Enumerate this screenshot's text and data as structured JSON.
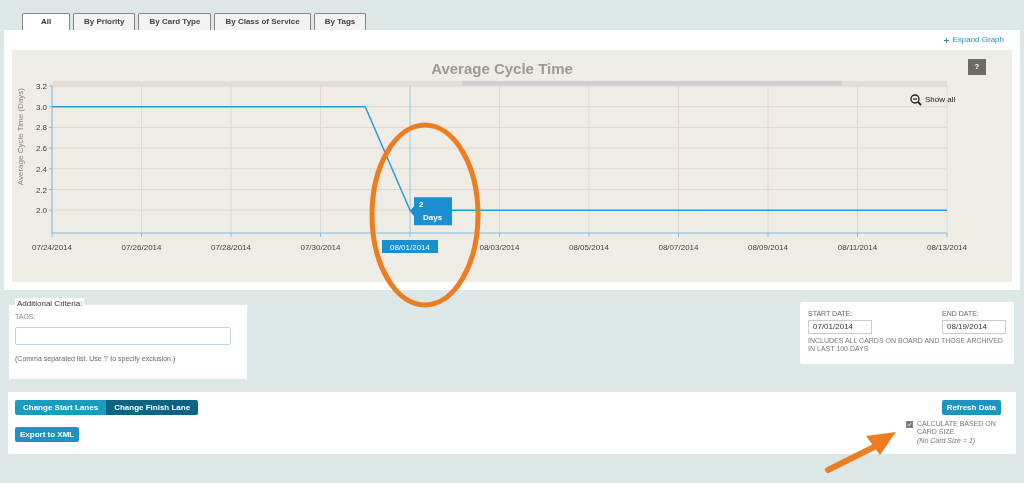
{
  "tabs": [
    {
      "label": "All",
      "selected": true
    },
    {
      "label": "By Priority",
      "selected": false
    },
    {
      "label": "By Card Type",
      "selected": false
    },
    {
      "label": "By Class of Service",
      "selected": false
    },
    {
      "label": "By Tags",
      "selected": false
    }
  ],
  "expand_link": "Expand Graph",
  "help_button": "?",
  "show_all": "Show all",
  "chart": {
    "chart_data": {
      "type": "line",
      "title": "Average Cycle Time",
      "ylabel": "Average Cycle Time (Days)",
      "categories": [
        "07/24/2014",
        null,
        "07/26/2014",
        null,
        "07/28/2014",
        null,
        "07/30/2014",
        null,
        "08/01/2014",
        null,
        "08/03/2014",
        null,
        "08/05/2014",
        null,
        "08/07/2014",
        null,
        "08/09/2014",
        null,
        "08/11/2014",
        null,
        "08/13/2014"
      ],
      "series": [
        {
          "color": "#2a9fd6",
          "values": [
            3.0,
            3.0,
            3.0,
            3.0,
            3.0,
            3.0,
            3.0,
            3.0,
            2.0,
            2.0,
            2.0,
            2.0,
            2.0,
            2.0,
            2.0,
            2.0,
            2.0,
            2.0,
            2.0,
            2.0,
            2.0
          ]
        }
      ],
      "ylim": [
        1.78,
        3.2
      ],
      "yticks": [
        {
          "value": 2.0,
          "label": "2.0"
        },
        {
          "value": 2.2,
          "label": "2.2"
        },
        {
          "value": 2.4,
          "label": "2.4"
        },
        {
          "value": 2.6,
          "label": "2.6"
        },
        {
          "value": 2.8,
          "label": "2.8"
        },
        {
          "value": 3.0,
          "label": "3.0"
        },
        {
          "value": 3.2,
          "label": "3.2"
        }
      ],
      "grid": true,
      "ref_lines": [
        {
          "axis": "x",
          "value": "08/01/2014",
          "color": "#9ccbe0"
        }
      ],
      "annotations": [
        {
          "x": "08/01/2014",
          "y": 2.0,
          "text": "2 Days"
        }
      ]
    }
  },
  "criteria": {
    "legend": "Additional Criteria:",
    "tags_label": "TAGS:",
    "hint": "(Comma separated list. Use '!' to specify exclusion.)"
  },
  "dates": {
    "start_label": "START DATE:",
    "start_value": "07/01/2014",
    "end_label": "END DATE:",
    "end_value": "08/19/2014",
    "note": "INCLUDES ALL CARDS ON BOARD AND THOSE ARCHIVED IN LAST 100 DAYS"
  },
  "lane_buttons": [
    {
      "label": "Change Start Lanes",
      "selected": false
    },
    {
      "label": "Change Finish Lane",
      "selected": true
    }
  ],
  "export_button": "Export to XML",
  "refresh_button": "Refresh Data",
  "card_size": {
    "label": "CALCULATE BASED ON CARD SIZE",
    "note": "(No Card Size = 1)",
    "checked": true
  }
}
